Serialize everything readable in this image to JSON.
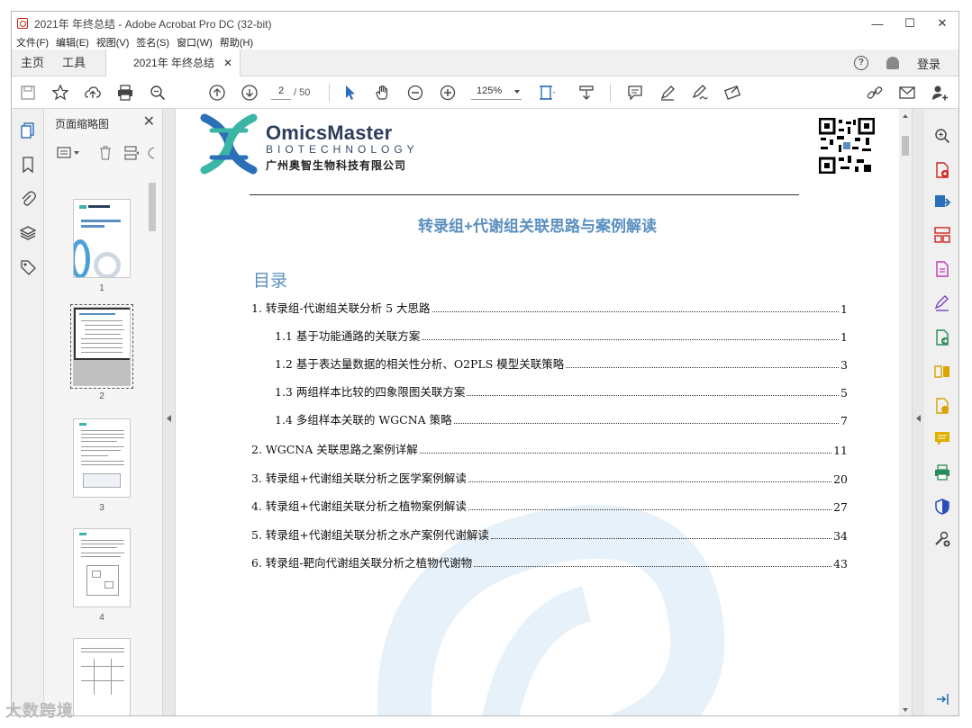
{
  "window": {
    "title": "2021年 年终总结 - Adobe Acrobat Pro DC (32-bit)",
    "controls": [
      "—",
      "☐",
      "✕"
    ]
  },
  "menu": [
    "文件(F)",
    "编辑(E)",
    "视图(V)",
    "签名(S)",
    "窗口(W)",
    "帮助(H)"
  ],
  "tabs": {
    "home": "主页",
    "tools": "工具",
    "doc": "2021年 年终总结",
    "login": "登录"
  },
  "toolbar": {
    "page_current": "2",
    "page_total": "/ 50",
    "zoom": "125%"
  },
  "thumbs": {
    "title": "页面缩略图",
    "pages": [
      "1",
      "2",
      "3",
      "4"
    ]
  },
  "doc": {
    "brand": "OmicsMaster",
    "brand_sub": "BIOTECHNOLOGY",
    "brand_cn": "广州奥智生物科技有限公司",
    "title": "转录组+代谢组关联思路与案例解读",
    "toc_heading": "目录",
    "toc": [
      {
        "label": "1.    转录组-代谢组关联分析 5 大思路",
        "page": "1",
        "indent": 0
      },
      {
        "label": "1.1  基于功能通路的关联方案",
        "page": "1",
        "indent": 26
      },
      {
        "label": "1.2  基于表达量数据的相关性分析、O2PLS 模型关联策略",
        "page": "3",
        "indent": 26
      },
      {
        "label": "1.3  两组样本比较的四象限图关联方案",
        "page": "5",
        "indent": 26
      },
      {
        "label": "1.4  多组样本关联的 WGCNA 策略",
        "page": "7",
        "indent": 26
      },
      {
        "label": "2. WGCNA 关联思路之案例详解",
        "page": "11",
        "indent": 0
      },
      {
        "label": "3.  转录组+代谢组关联分析之医学案例解读",
        "page": "20",
        "indent": 0
      },
      {
        "label": "4.  转录组+代谢组关联分析之植物案例解读",
        "page": "27",
        "indent": 0
      },
      {
        "label": "5.  转录组+代谢组关联分析之水产案例代谢解读",
        "page": "34",
        "indent": 0
      },
      {
        "label": "6.    转录组-靶向代谢组关联分析之植物代谢物",
        "page": "43",
        "indent": 0
      }
    ]
  },
  "bottom_watermark": "大数跨境",
  "colors": {
    "accent": "#5a8fc0",
    "teal": "#3bb5a5",
    "blue": "#2b6fb8",
    "red": "#d0241b"
  }
}
